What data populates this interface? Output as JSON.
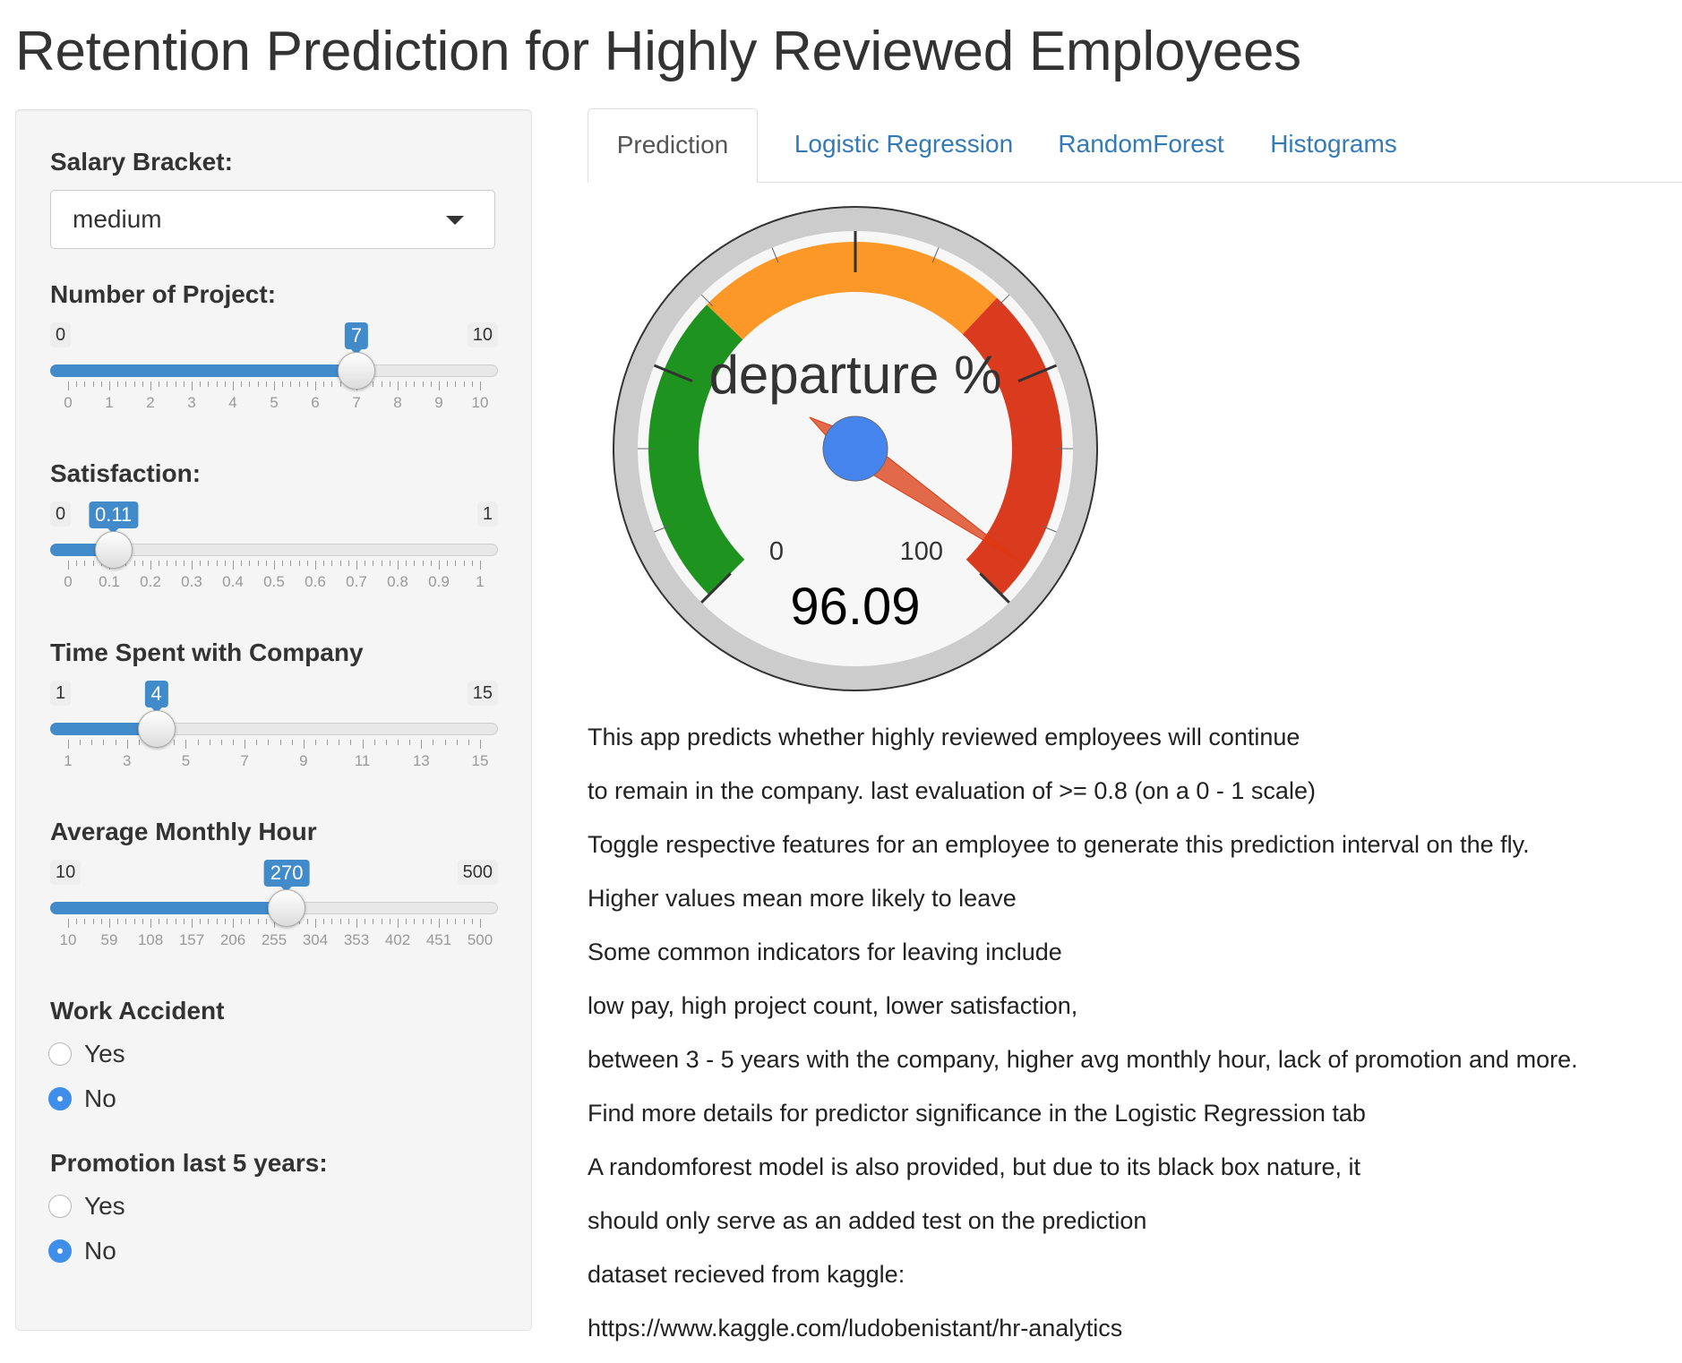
{
  "page": {
    "title": "Retention Prediction for Highly Reviewed Employees"
  },
  "sidebar": {
    "salary": {
      "label": "Salary Bracket:",
      "value": "medium"
    },
    "projects": {
      "label": "Number of Project:",
      "min": "0",
      "max": "10",
      "value": "7",
      "ticks": [
        "0",
        "1",
        "2",
        "3",
        "4",
        "5",
        "6",
        "7",
        "8",
        "9",
        "10"
      ]
    },
    "satisfaction": {
      "label": "Satisfaction:",
      "min": "0",
      "max": "1",
      "value": "0.11",
      "ticks": [
        "0",
        "0.1",
        "0.2",
        "0.3",
        "0.4",
        "0.5",
        "0.6",
        "0.7",
        "0.8",
        "0.9",
        "1"
      ]
    },
    "time_spent": {
      "label": "Time Spent with Company",
      "min": "1",
      "max": "15",
      "value": "4",
      "ticks": [
        "1",
        "3",
        "5",
        "7",
        "9",
        "11",
        "13",
        "15"
      ]
    },
    "monthly_hour": {
      "label": "Average Monthly Hour",
      "min": "10",
      "max": "500",
      "value": "270",
      "ticks": [
        "10",
        "59",
        "108",
        "157",
        "206",
        "255",
        "304",
        "353",
        "402",
        "451",
        "500"
      ]
    },
    "work_accident": {
      "label": "Work Accident",
      "options": [
        "Yes",
        "No"
      ],
      "selected": "No"
    },
    "promotion": {
      "label": "Promotion last 5 years:",
      "options": [
        "Yes",
        "No"
      ],
      "selected": "No"
    }
  },
  "tabs": [
    {
      "label": "Prediction",
      "active": true
    },
    {
      "label": "Logistic Regression",
      "active": false
    },
    {
      "label": "RandomForest",
      "active": false
    },
    {
      "label": "Histograms",
      "active": false
    }
  ],
  "gauge": {
    "title": "departure %",
    "min_label": "0",
    "max_label": "100",
    "value": 96.09,
    "value_label": "96.09",
    "min": 0,
    "max": 100,
    "bands": [
      {
        "from": 0,
        "to": 33,
        "color": "#1e9320"
      },
      {
        "from": 33,
        "to": 66,
        "color": "#fb9828"
      },
      {
        "from": 66,
        "to": 100,
        "color": "#da3a1e"
      }
    ],
    "needle_color": "#dc3912",
    "hub_color": "#4684ee"
  },
  "description": [
    "This app predicts whether highly reviewed employees will continue",
    "to remain in the company. last evaluation of >= 0.8 (on a 0 - 1 scale)",
    "Toggle respective features for an employee to generate this prediction interval on the fly.",
    "Higher values mean more likely to leave",
    "Some common indicators for leaving include",
    "low pay, high project count, lower satisfaction,",
    "between 3 - 5 years with the company, higher avg monthly hour, lack of promotion and more.",
    "Find more details for predictor significance in the Logistic Regression tab",
    "A randomforest model is also provided, but due to its black box nature, it",
    "should only serve as an added test on the prediction",
    "dataset recieved from kaggle:",
    "https://www.kaggle.com/ludobenistant/hr-analytics"
  ]
}
